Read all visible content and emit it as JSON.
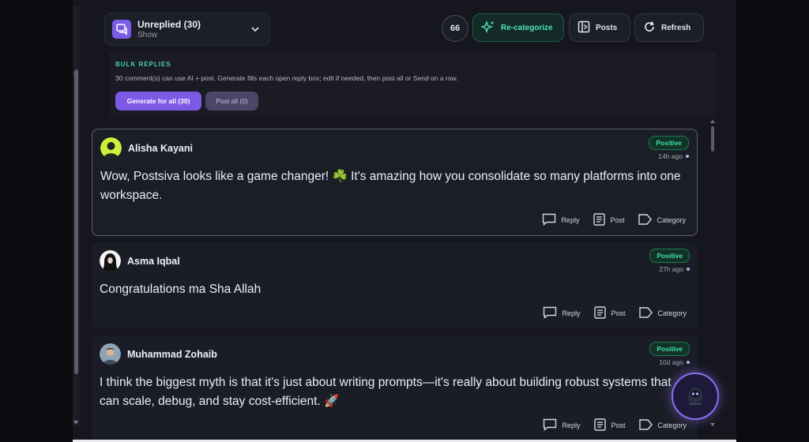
{
  "filter": {
    "label": "Unreplied (30)",
    "sublabel": "Show"
  },
  "toolbar": {
    "count": "66",
    "recategorize_label": "Re-categorize",
    "posts_label": "Posts",
    "refresh_label": "Refresh"
  },
  "bulk": {
    "title": "BULK REPLIES",
    "description": "30 comment(s) can use AI + post. Generate fills each open reply box; edit if needed, then post all or Send on a row.",
    "generate_label": "Generate for all (30)",
    "post_all_label": "Post all (0)"
  },
  "comments": [
    {
      "author": "Alisha Kayani",
      "sentiment": "Positive",
      "time": "14h ago",
      "text": "Wow, Postsiva looks like a game changer! ☘️ It's amazing how you consolidate so many platforms into one workspace.",
      "reply_label": "Reply",
      "post_label": "Post",
      "category_label": "Category"
    },
    {
      "author": "Asma Iqbal",
      "sentiment": "Positive",
      "time": "27h ago",
      "text": "Congratulations ma Sha Allah",
      "reply_label": "Reply",
      "post_label": "Post",
      "category_label": "Category"
    },
    {
      "author": "Muhammad Zohaib",
      "sentiment": "Positive",
      "time": "10d ago",
      "text": "I think the biggest myth is that it's just about writing prompts—it's really about building robust systems that can scale, debug, and stay cost-efficient. 🚀",
      "reply_label": "Reply",
      "post_label": "Post",
      "category_label": "Category"
    }
  ],
  "colors": {
    "accent": "#7c5ae6",
    "teal": "#44d5ae",
    "positive": "#3ee0a4"
  },
  "icons": [
    "chat-icon",
    "chevron-down-icon",
    "sparkles-icon",
    "posts-panel-icon",
    "refresh-icon",
    "reply-icon",
    "post-icon",
    "tag-icon",
    "bot-icon"
  ]
}
